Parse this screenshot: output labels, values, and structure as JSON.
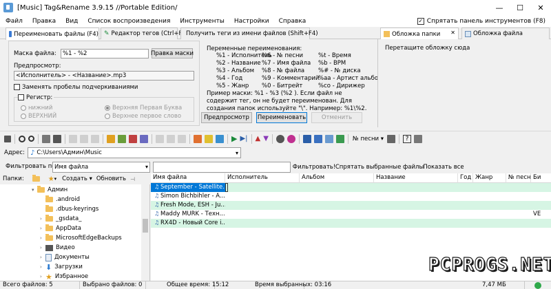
{
  "window": {
    "title": "[Music] Tag&Rename 3.9.15 //Portable Edition/",
    "minimize": "—",
    "maximize": "☐",
    "close": "✕"
  },
  "menu": {
    "items": [
      "Файл",
      "Правка",
      "Вид",
      "Список воспроизведения",
      "Инструменты",
      "Настройки",
      "Справка"
    ],
    "hide_toolbar": "Спрятать панель инструментов (F8)"
  },
  "tabs": {
    "rename_files": "Переименовать файлы (F4)",
    "tag_editor": "Редактор тегов (Ctrl+F4)",
    "tags_from_names": "Получить теги из имени файлов (Shift+F4)",
    "folder_cover": "Обложка папки",
    "file_cover": "Обложка файла"
  },
  "rename": {
    "mask_label": "Маска файла:",
    "mask_value": "%1 - %2",
    "edit_mask_button": "Правка маски",
    "preview_label": "Предпросмотр:",
    "preview_value": "<Исполнитель> - <Название>.mp3",
    "replace_spaces": "Заменять пробелы подчеркиваниями",
    "case_label": "Регистр:",
    "case_lower": "нижний",
    "case_upper": "ВЕРХНИЙ",
    "case_title": "Верхняя Первая Буква",
    "case_sentence": "Верхнее первое слово",
    "vars_title": "Переменные переименования:",
    "vars_col1": [
      "%1 - Исполнитель",
      "%2 - Название",
      "%3 - Альбом",
      "%4 - Год",
      "%5 - Жанр"
    ],
    "vars_col2": [
      "%6 - № песни",
      "%7 - Имя файла",
      "%8 - № файла",
      "%9 - Комментарий",
      "%0 - Битрейт"
    ],
    "vars_col3": [
      "%t - Время",
      "%b - BPM",
      "%# - № диска",
      "%aa - Артист альбома",
      "%co - Дирижер"
    ],
    "example_line1": "Пример маски: %1 - %3 (%2 ). Если файл не",
    "example_line2": "содержит тег, он не будет переименован. Для",
    "example_line3": "создания папок используйте \"\\\". Например: %1\\%2.",
    "preview_button": "Предпросмотр",
    "rename_button": "Переименовать",
    "cancel_button": "Отменить"
  },
  "cover": {
    "drag_hint": "Перетащите обложку сюда"
  },
  "toolbar": {
    "track_number_dropdown": "№ песни",
    "help": "?"
  },
  "address": {
    "label": "Адрес:",
    "path": "C:\\Users\\Админ\\Music"
  },
  "filter": {
    "filter_by_label": "Фильтровать по",
    "filter_field": "Имя файла",
    "filter_value": "",
    "filter_button": "Фильтровать!",
    "hide_selected_button": "Спрятать выбранные файлы",
    "show_all_button": "Показать все"
  },
  "folders": {
    "label": "Папки:",
    "create_button": "Создать",
    "refresh_button": "Обновить",
    "tree": [
      {
        "name": "Админ",
        "expanded": true
      },
      {
        "name": ".android",
        "expanded": false
      },
      {
        "name": ".dbus-keyrings",
        "expanded": false
      },
      {
        "name": "_gsdata_",
        "expanded": false
      },
      {
        "name": "AppData",
        "expanded": false
      },
      {
        "name": "MicrosoftEdgeBackups",
        "expanded": false
      },
      {
        "name": "Видео",
        "expanded": false
      },
      {
        "name": "Документы",
        "expanded": false
      },
      {
        "name": "Загрузки",
        "expanded": false
      },
      {
        "name": "Избранное",
        "expanded": false
      }
    ]
  },
  "filelist": {
    "columns": [
      "Имя файла",
      "Исполнитель",
      "Альбом",
      "Название",
      "Год",
      "Жанр",
      "№ песни",
      "Би"
    ],
    "rows": [
      {
        "name": "September - Satellite...",
        "last": ""
      },
      {
        "name": "Simon Bichbihler - A...",
        "last": ""
      },
      {
        "name": "Fresh Mode, ESH - Ju...",
        "last": ""
      },
      {
        "name": "Maddy MURK - Техн...",
        "last": "VE"
      },
      {
        "name": "RX4D - Новый Core i...",
        "last": ""
      }
    ]
  },
  "status": {
    "total_files": "Всего файлов: 5",
    "selected_files": "Выбрано файлов: 0",
    "total_time": "Общее время: 15:12",
    "selected_time": "Время выбранных: 03:16",
    "size": "7,47 МБ"
  },
  "watermark": "PCPROGS.NET",
  "colors": {
    "row_highlight": "#d6f5e4",
    "row_selected": "#0078d7",
    "accent": "#1e73c8"
  }
}
